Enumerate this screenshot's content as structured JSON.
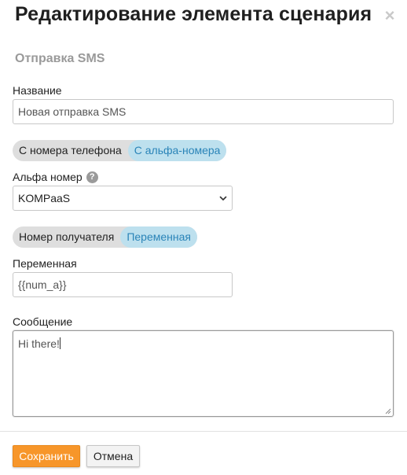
{
  "dialog": {
    "title": "Редактирование элемента сценария",
    "close_label": "×",
    "subtitle": "Отправка SMS"
  },
  "form": {
    "name_label": "Название",
    "name_value": "Новая отправка SMS",
    "sender_toggle": {
      "options": [
        "С номера телефона",
        "С альфа-номера"
      ],
      "active_index": 1
    },
    "alpha_label": "Альфа номер",
    "alpha_help": "?",
    "alpha_value": "KOMPaaS",
    "recipient_toggle": {
      "options": [
        "Номер получателя",
        "Переменная"
      ],
      "active_index": 1
    },
    "variable_label": "Переменная",
    "variable_value": "{{num_a}}",
    "message_label": "Сообщение",
    "message_value": "Hi there!"
  },
  "footer": {
    "save_label": "Сохранить",
    "cancel_label": "Отмена"
  },
  "colors": {
    "primary": "#f7962a",
    "toggle_active_bg": "#bde0ee",
    "toggle_active_text": "#2a84b8"
  },
  "icons": {
    "close": "close-icon",
    "help": "help-icon",
    "dropdown": "chevron-down-icon",
    "resize": "resize-grip-icon"
  }
}
